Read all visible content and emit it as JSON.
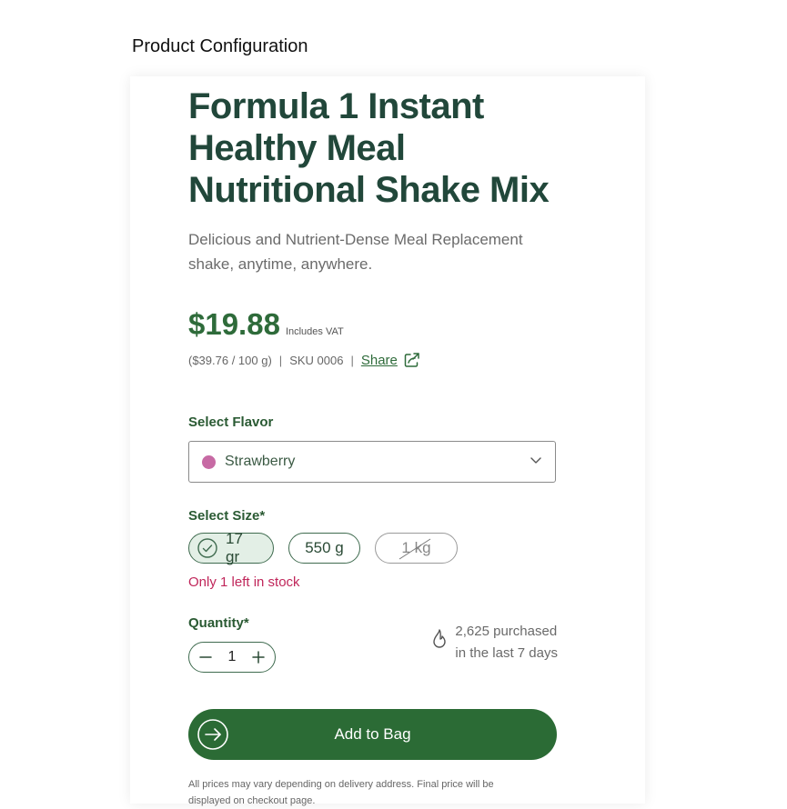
{
  "page_heading": "Product Configuration",
  "product": {
    "title_line1": "Formula 1 Instant",
    "title_line2": "Healthy Meal",
    "title_line3": "Nutritional Shake Mix",
    "subtitle_line1": "Delicious and Nutrient-Dense Meal Replacement",
    "subtitle_line2": "shake, anytime, anywhere."
  },
  "pricing": {
    "price": "$19.88",
    "vat_note": "Includes VAT",
    "unit_price": "($39.76 / 100 g)",
    "separator": "|",
    "sku": "SKU 0006",
    "share_label": "Share"
  },
  "flavor": {
    "label": "Select Flavor",
    "selected": "Strawberry",
    "swatch_color": "#c76aa4"
  },
  "size": {
    "label": "Select Size*",
    "options": [
      {
        "label": "17 gr",
        "state": "selected"
      },
      {
        "label": "550 g",
        "state": "available"
      },
      {
        "label": "1 kg",
        "state": "unavailable"
      }
    ],
    "stock_note": "Only 1 left in stock"
  },
  "quantity": {
    "label": "Quantity*",
    "value": "1"
  },
  "social_proof": {
    "line1": "2,625 purchased",
    "line2": "in the last 7 days"
  },
  "cart": {
    "add_label": "Add to Bag"
  },
  "disclaimer": {
    "line1": "All prices may vary depending on delivery address. Final price will be",
    "line2": "displayed on checkout page."
  },
  "colors": {
    "brand_green": "#2b6b35",
    "title_green": "#21473a",
    "stock_red": "#c0265a"
  },
  "icons": {
    "share": "share-icon",
    "dropdown": "chevron-down-icon",
    "check": "check-circle-icon",
    "minus": "minus-icon",
    "plus": "plus-icon",
    "flame": "flame-icon",
    "add_to_bag": "arrow-circle-icon"
  }
}
